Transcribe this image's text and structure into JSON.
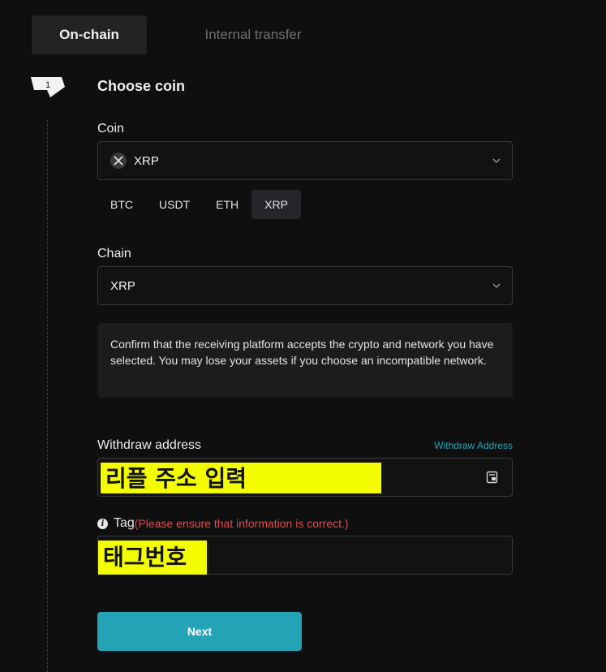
{
  "tabs": {
    "onchain": "On-chain",
    "internal": "Internal transfer"
  },
  "step": {
    "number": "1",
    "title": "Choose coin"
  },
  "coin": {
    "label": "Coin",
    "selected": "XRP",
    "icon": "xrp-icon",
    "quick": [
      "BTC",
      "USDT",
      "ETH",
      "XRP"
    ],
    "quick_selected": "XRP"
  },
  "chain": {
    "label": "Chain",
    "selected": "XRP"
  },
  "notice": "Confirm that the receiving platform accepts the crypto and network you have selected. You may lose your assets if you choose an incompatible network.",
  "withdraw": {
    "label": "Withdraw address",
    "link": "Withdraw Address",
    "value": "리플 주소 입력",
    "icon": "address-book-icon"
  },
  "tag": {
    "label": "Tag",
    "warning": "(Please ensure that information is correct.)",
    "value": "태그번호"
  },
  "next_label": "Next",
  "colors": {
    "accent": "#23a3b5",
    "highlight": "#f4fc00",
    "warning": "#e24c4c",
    "background": "#0f0f10"
  }
}
